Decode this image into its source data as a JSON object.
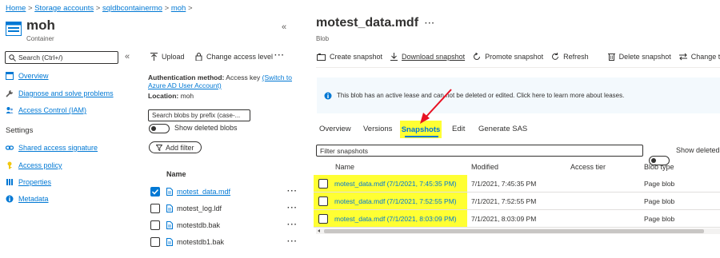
{
  "breadcrumb": {
    "home": "Home",
    "sep": ">",
    "storage": "Storage accounts",
    "account": "sqldbcontainermo",
    "container": "moh"
  },
  "container_header": {
    "title": "moh",
    "subtitle": "Container",
    "collapse": "«"
  },
  "sidebar": {
    "search_placeholder": "Search (Ctrl+/)",
    "collapse": "«",
    "items": [
      {
        "label": "Overview",
        "icon": "overview-icon",
        "color": "#0078d4"
      },
      {
        "label": "Diagnose and solve problems",
        "icon": "wrench-icon",
        "color": "#605e5c"
      },
      {
        "label": "Access Control (IAM)",
        "icon": "people-icon",
        "color": "#0078d4"
      }
    ],
    "settings_heading": "Settings",
    "settings_items": [
      {
        "label": "Shared access signature",
        "icon": "link-icon",
        "color": "#0078d4"
      },
      {
        "label": "Access policy",
        "icon": "key-icon",
        "color": "#f2c811"
      },
      {
        "label": "Properties",
        "icon": "properties-icon",
        "color": "#0078d4"
      },
      {
        "label": "Metadata",
        "icon": "info-icon",
        "color": "#0078d4"
      }
    ]
  },
  "container_toolbar": {
    "upload": "Upload",
    "change_access": "Change access level",
    "more": "···"
  },
  "container_info": {
    "auth_label": "Authentication method:",
    "auth_value": "Access key",
    "switch_link": "(Switch to",
    "switch_link2": "Azure AD User Account)",
    "location_label": "Location:",
    "location_value": "moh",
    "search_placeholder": "Search blobs by prefix (case-...",
    "show_deleted": "Show deleted blobs",
    "add_filter": "Add filter"
  },
  "blob_list": {
    "header": "Name",
    "rows": [
      {
        "name": "motest_data.mdf",
        "checked": true,
        "more": "···"
      },
      {
        "name": "motest_log.ldf",
        "checked": false,
        "more": "···"
      },
      {
        "name": "motestdb.bak",
        "checked": false,
        "more": "···"
      },
      {
        "name": "motestdb1.bak",
        "checked": false,
        "more": "···"
      }
    ]
  },
  "blob_header": {
    "title": "motest_data.mdf",
    "more": "···",
    "subtitle": "Blob"
  },
  "blob_toolbar": {
    "create_snapshot": "Create snapshot",
    "download_snapshot": "Download snapshot",
    "promote_snapshot": "Promote snapshot",
    "refresh": "Refresh",
    "delete_snapshot": "Delete snapshot",
    "change_tier": "Change tier"
  },
  "lease_notice": "This blob has an active lease and can not be deleted or edited. Click here to learn more about leases.",
  "tabs": [
    {
      "label": "Overview",
      "active": false
    },
    {
      "label": "Versions",
      "active": false
    },
    {
      "label": "Snapshots",
      "active": true
    },
    {
      "label": "Edit",
      "active": false
    },
    {
      "label": "Generate SAS",
      "active": false
    }
  ],
  "snapshots": {
    "filter_placeholder": "Filter snapshots",
    "show_deleted": "Show deleted",
    "columns": [
      "Name",
      "Modified",
      "Access tier",
      "Blob type"
    ],
    "rows": [
      {
        "name": "motest_data.mdf (7/1/2021, 7:45:35 PM)",
        "modified": "7/1/2021, 7:45:35 PM",
        "tier": "",
        "type": "Page blob"
      },
      {
        "name": "motest_data.mdf (7/1/2021, 7:52:55 PM)",
        "modified": "7/1/2021, 7:52:55 PM",
        "tier": "",
        "type": "Page blob"
      },
      {
        "name": "motest_data.mdf (7/1/2021, 8:03:09 PM)",
        "modified": "7/1/2021, 8:03:09 PM",
        "tier": "",
        "type": "Page blob"
      }
    ]
  },
  "colors": {
    "accent": "#0078d4",
    "highlight": "#ffff33",
    "arrow": "#e81123"
  }
}
